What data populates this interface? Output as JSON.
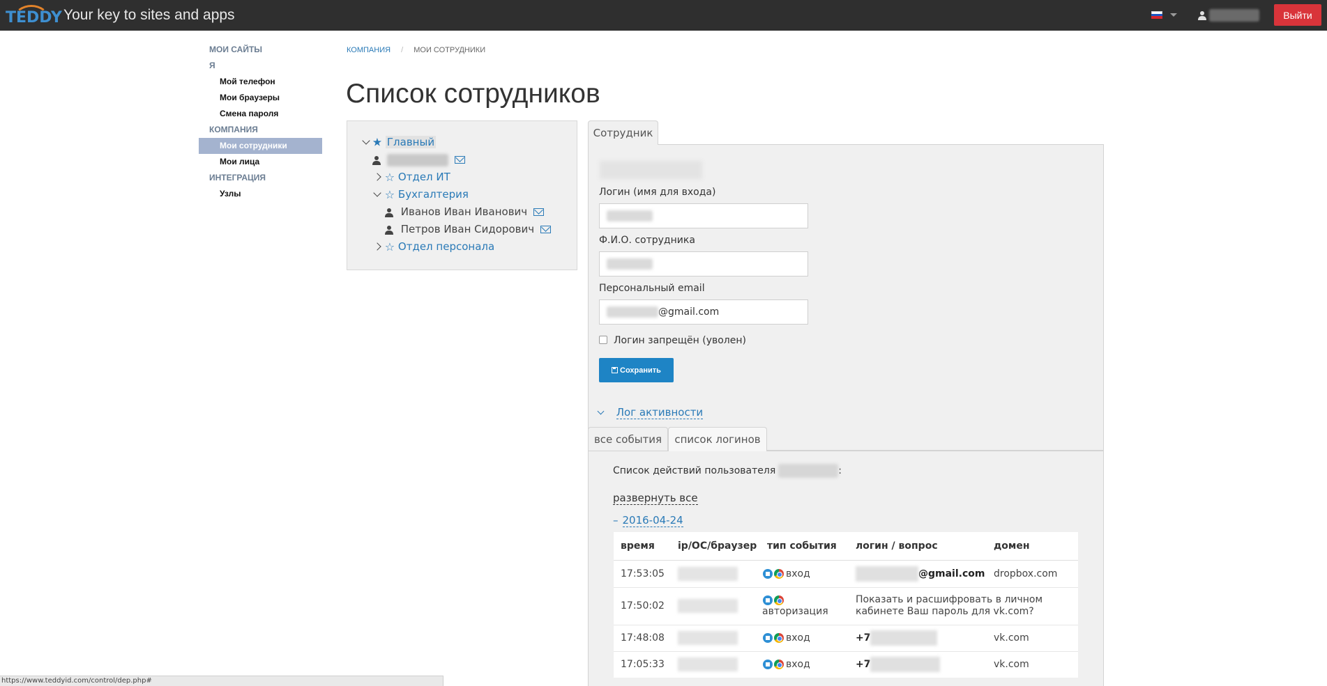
{
  "topbar": {
    "logo_text": "TEDDY",
    "tagline": "Your key to sites and apps",
    "language": "RU",
    "logout_label": "Выйти"
  },
  "sidebar": {
    "items": [
      {
        "label": "МОИ САЙТЫ",
        "kind": "head"
      },
      {
        "label": "Я",
        "kind": "head"
      },
      {
        "label": "Мой телефон",
        "kind": "sub"
      },
      {
        "label": "Мои браузеры",
        "kind": "sub"
      },
      {
        "label": "Смена пароля",
        "kind": "sub"
      },
      {
        "label": "КОМПАНИЯ",
        "kind": "head"
      },
      {
        "label": "Мои сотрудники",
        "kind": "sub",
        "active": true
      },
      {
        "label": "Мои лица",
        "kind": "sub"
      },
      {
        "label": "ИНТЕГРАЦИЯ",
        "kind": "head"
      },
      {
        "label": "Узлы",
        "kind": "sub"
      }
    ]
  },
  "breadcrumb": {
    "items": [
      "КОМПАНИЯ",
      "МОИ СОТРУДНИКИ"
    ],
    "separator": "/"
  },
  "page_title": "Список сотрудников",
  "tree": {
    "root": "Главный",
    "it_dept": "Отдел ИТ",
    "accounting": "Бухгалтерия",
    "emp1": "Иванов Иван Иванович",
    "emp2": "Петров Иван Сидорович",
    "hr_dept": "Отдел персонала"
  },
  "employee": {
    "tab_label": "Сотрудник",
    "login_label": "Логин (имя для входа)",
    "fio_label": "Ф.И.О. сотрудника",
    "email_label": "Персональный email",
    "email_suffix": "@gmail.com",
    "banned_label": "Логин запрещён (уволен)",
    "save_label": "Сохранить"
  },
  "activity": {
    "toggle_label": "Лог активности",
    "tabs": [
      "все события",
      "список логинов"
    ],
    "action_text": "Список действий пользователя",
    "action_suffix": ":",
    "expand_all": "развернуть все",
    "date_minus": "–",
    "date": "2016-04-24",
    "columns": [
      "время",
      "ip/ОС/браузер",
      "тип события",
      "логин / вопрос",
      "домен"
    ],
    "rows": [
      {
        "time": "17:53:05",
        "type": "вход",
        "login": "@gmail.com",
        "domain": "dropbox.com"
      },
      {
        "time": "17:50:02",
        "type": "авторизация",
        "login": "Показать и расшифровать в личном кабинете Ваш пароль для vk.com?",
        "domain": ""
      },
      {
        "time": "17:48:08",
        "type": "вход",
        "login": "+7",
        "domain": "vk.com"
      },
      {
        "time": "17:05:33",
        "type": "вход",
        "login": "+7",
        "domain": "vk.com"
      }
    ]
  },
  "statusbar": {
    "url": "https://www.teddyid.com/control/dep.php#"
  },
  "colors": {
    "topbar_bg": "#2f2f2f",
    "logout_bg": "#d9343a",
    "link_blue": "#2a7ab7",
    "save_bg": "#1e84c5",
    "sidebar_active_bg": "#a4b3cf"
  }
}
